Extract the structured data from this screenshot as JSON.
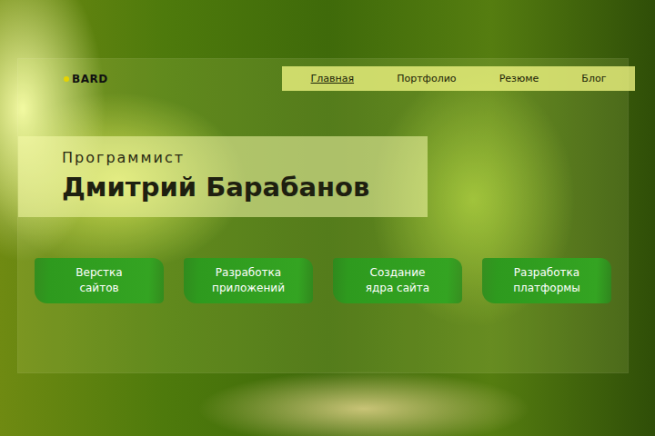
{
  "logo": "BARD",
  "nav": [
    {
      "label": "Главная",
      "selected": true
    },
    {
      "label": "Портфолио",
      "selected": false
    },
    {
      "label": "Резюме",
      "selected": false
    },
    {
      "label": "Блог",
      "selected": false
    }
  ],
  "hero": {
    "subtitle": "Программист",
    "name": "Дмитрий Барабанов"
  },
  "services": [
    {
      "lines": [
        "Верстка",
        "сайтов"
      ]
    },
    {
      "lines": [
        "Разработка",
        "приложений"
      ]
    },
    {
      "lines": [
        "Создание",
        "ядра сайта"
      ]
    },
    {
      "lines": [
        "Разработка",
        "платформы"
      ]
    }
  ]
}
